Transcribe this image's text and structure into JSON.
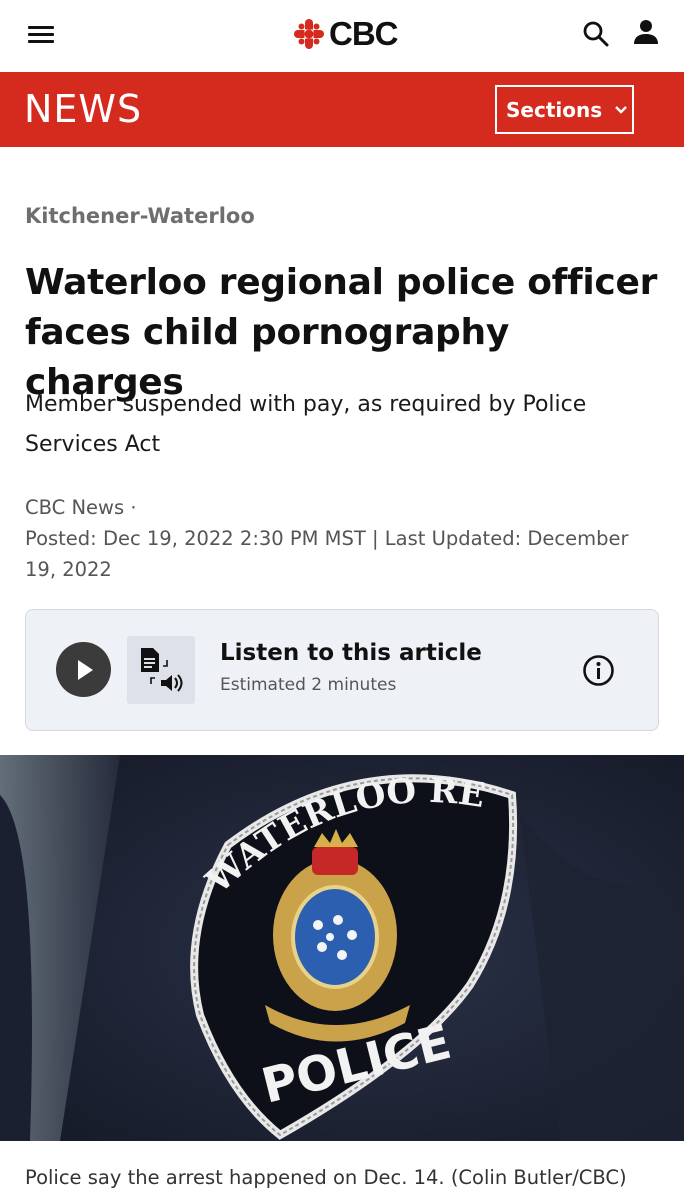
{
  "header": {
    "logo_text": "CBC",
    "menu_icon": "hamburger-menu-icon",
    "search_icon": "search-icon",
    "user_icon": "user-icon"
  },
  "newsbar": {
    "label": "NEWS",
    "sections_label": "Sections",
    "accent_color": "#d52b1e"
  },
  "article": {
    "category": "Kitchener-Waterloo",
    "headline": "Waterloo regional police officer faces child pornography charges",
    "deck": "Member suspended with pay, as required by Police Services Act",
    "byline_source": "CBC News ·",
    "byline_dates": "Posted: Dec 19, 2022 2:30 PM MST | Last Updated: December 19, 2022"
  },
  "listen": {
    "title": "Listen to this article",
    "subtitle": "Estimated 2 minutes",
    "play_icon": "play-icon",
    "tts_icon": "text-to-speech-icon",
    "info_icon": "info-icon"
  },
  "photo": {
    "patch_top_text": "WATERLOO REGIONAL",
    "patch_bottom_text": "POLICE",
    "caption": "Police say the arrest happened on Dec. 14. (Colin Butler/CBC)"
  }
}
